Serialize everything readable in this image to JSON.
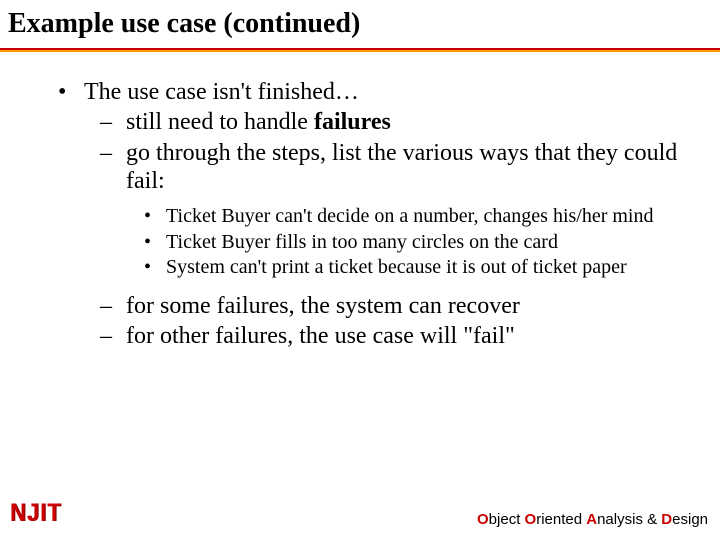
{
  "title": "Example use case (continued)",
  "bullets": {
    "lvl1": "The use case isn't finished…",
    "lvl2a": "still need to handle ",
    "lvl2a_bold": "failures",
    "lvl2b": "go through the steps, list the various ways that they could fail:",
    "lvl3a": "Ticket Buyer can't decide on a number, changes his/her mind",
    "lvl3b": "Ticket Buyer fills in too many circles on the card",
    "lvl3c": "System can't print a ticket because it is out of ticket paper",
    "lvl2c": "for some failures, the system can recover",
    "lvl2d": "for other failures, the use case will \"fail\""
  },
  "footer": {
    "o1": "O",
    "w1": "bject ",
    "o2": "O",
    "w2": "riented ",
    "a": "A",
    "w3": "nalysis & ",
    "d": "D",
    "w4": "esign"
  },
  "logo": "NJIT",
  "colors": {
    "accent_red": "#cc0000",
    "accent_orange": "#ff9900"
  }
}
